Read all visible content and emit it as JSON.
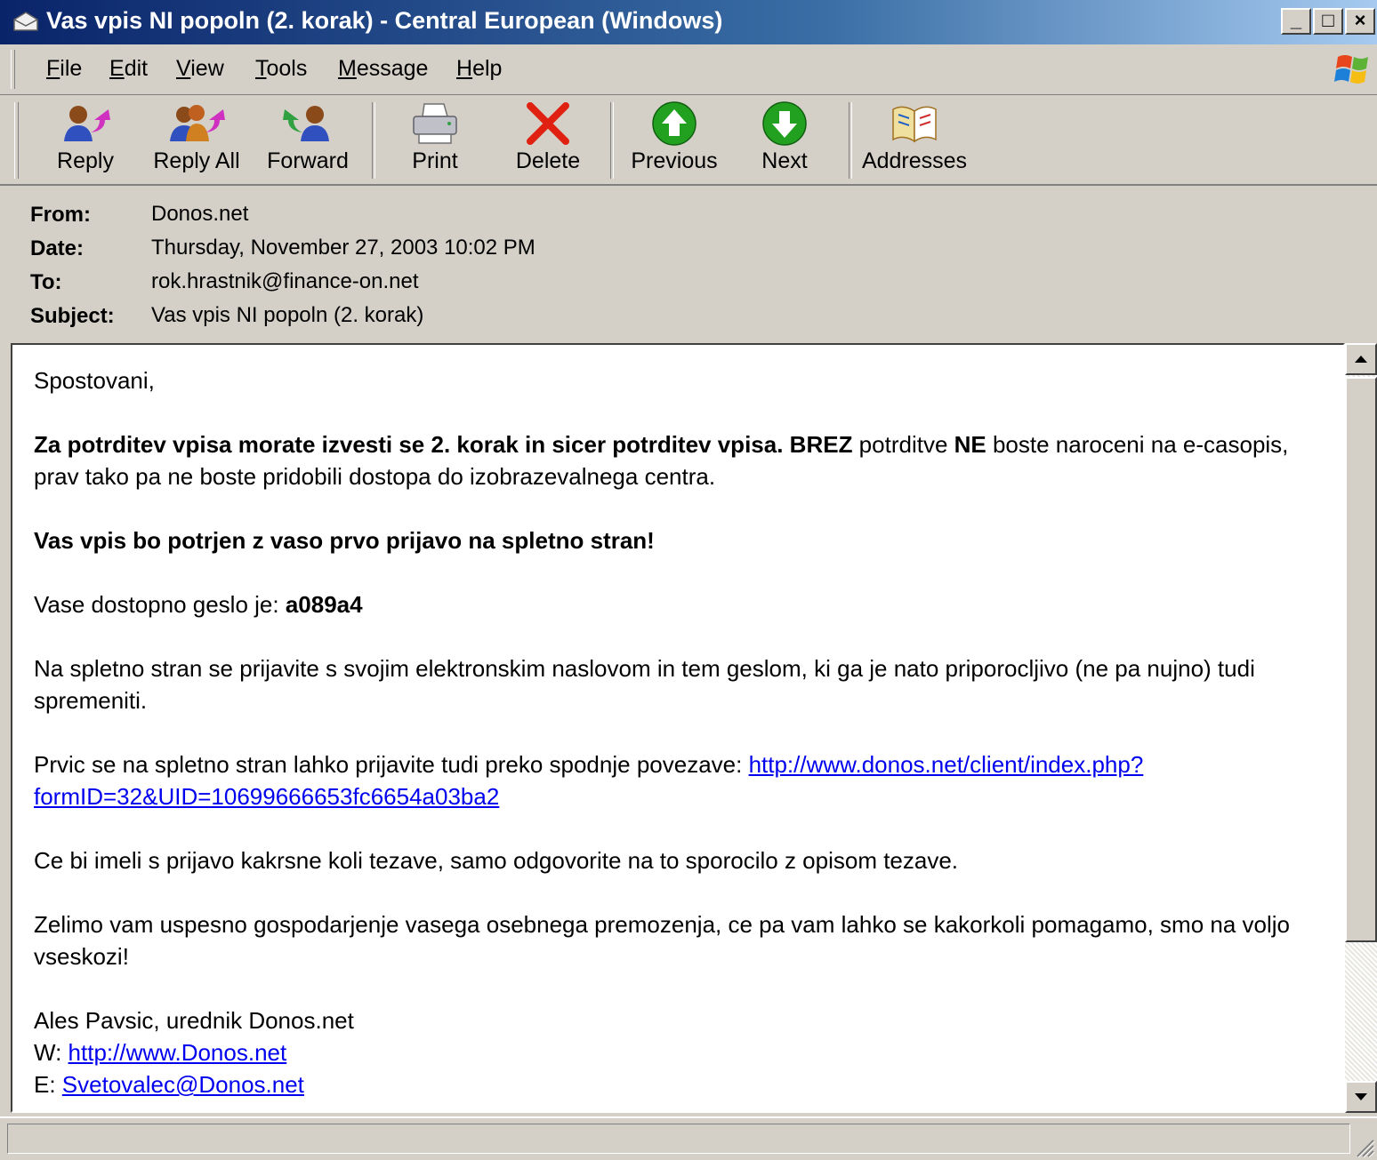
{
  "window": {
    "title": "Vas vpis NI popoln (2. korak) - Central European (Windows)",
    "controls": {
      "minimize": "_",
      "maximize": "□",
      "close": "×"
    }
  },
  "menu": [
    "File",
    "Edit",
    "View",
    "Tools",
    "Message",
    "Help"
  ],
  "toolbar": {
    "reply": "Reply",
    "reply_all": "Reply All",
    "forward": "Forward",
    "print": "Print",
    "delete": "Delete",
    "previous": "Previous",
    "next": "Next",
    "addresses": "Addresses"
  },
  "headers": {
    "from_label": "From:",
    "from": "Donos.net",
    "date_label": "Date:",
    "date": "Thursday, November 27, 2003 10:02 PM",
    "to_label": "To:",
    "to": "rok.hrastnik@finance-on.net",
    "subject_label": "Subject:",
    "subject": "Vas vpis NI popoln (2. korak)"
  },
  "body": {
    "greeting": "Spostovani,",
    "p1_bold": "Za potrditev vpisa morate izvesti se 2. korak in sicer potrditev vpisa.",
    "p1_brez": "BREZ",
    "p1_mid": " potrditve ",
    "p1_ne": "NE",
    "p1_rest": " boste naroceni na e-casopis, prav tako pa ne boste pridobili dostopa do izobrazevalnega centra.",
    "p2": "Vas vpis bo potrjen z vaso prvo prijavo na spletno stran!",
    "p3_text": "Vase dostopno geslo je: ",
    "p3_password": "a089a4",
    "p4": "Na spletno stran se prijavite s svojim elektronskim naslovom in tem geslom, ki ga je nato priporocljivo (ne pa nujno) tudi spremeniti.",
    "p5_text": "Prvic se na spletno stran lahko prijavite tudi preko spodnje povezave: ",
    "p5_link": "http://www.donos.net/client/index.php?formID=32&UID=10699666653fc6654a03ba2",
    "p6": "Ce bi imeli s prijavo kakrsne koli tezave, samo odgovorite na to sporocilo z opisom tezave.",
    "p7": "Zelimo vam uspesno gospodarjenje vasega osebnega premozenja, ce pa vam lahko se kakorkoli pomagamo, smo na voljo vseskozi!",
    "sig_name": "Ales Pavsic, urednik Donos.net",
    "sig_w_label": "W: ",
    "sig_w_link": "http://www.Donos.net",
    "sig_e_label": "E: ",
    "sig_e_link": "Svetovalec@Donos.net"
  },
  "colors": {
    "titlebar_start": "#0a246a",
    "titlebar_end": "#a6caf0",
    "chrome": "#d4d0c8",
    "link": "#0000ee",
    "delete_red": "#e02010",
    "nav_green": "#22a020"
  },
  "icons": [
    "envelope-icon",
    "windows-logo-icon",
    "reply-icon",
    "reply-all-icon",
    "forward-icon",
    "printer-icon",
    "delete-x-icon",
    "up-arrow-icon",
    "down-arrow-icon",
    "address-book-icon"
  ]
}
